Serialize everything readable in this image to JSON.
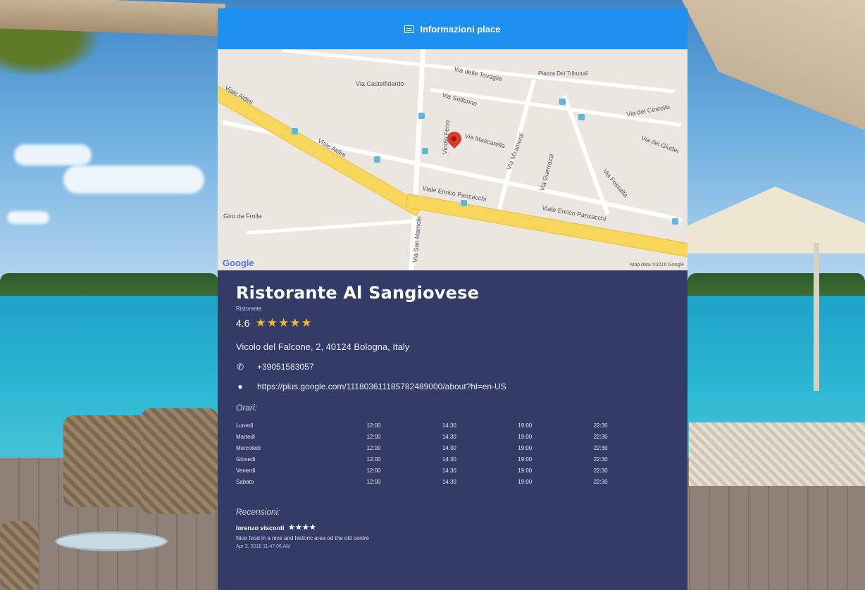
{
  "header": {
    "title": "Informazioni place",
    "icon": "calendar-icon"
  },
  "map": {
    "provider_logo": "Google",
    "credit": "Map data ©2016 Google",
    "streets": [
      "Viale Aldini",
      "Viale Aldini",
      "Viale Enrico Panzacchi",
      "Viale Enrico Panzacchi",
      "Via Castelfidardo",
      "Via delle Tovaglie",
      "Piazza Dei Tribunali",
      "Via Solferino",
      "Via Miramonti",
      "Via del Cestello",
      "Via Mascarella",
      "Via Guerrazzi",
      "Via Fossalta",
      "Via dei Giudei",
      "Vicolo Ferro",
      "Via San Mamolo",
      "Giro da Frolla"
    ],
    "marker_icon": "map-pin-icon"
  },
  "place": {
    "name": "Ristorante Al Sangiovese",
    "type": "Ristorante",
    "rating": "4.6",
    "rating_stars": 5,
    "address": "Vicolo del Falcone, 2, 40124 Bologna, Italy",
    "phone": "+39051583057",
    "phone_icon": "phone-icon",
    "website": "https://plus.google.com/111803611185782489000/about?hl=en-US",
    "website_icon": "globe-icon"
  },
  "hours": {
    "title": "Orari:",
    "rows": [
      {
        "day": "Lunedì",
        "t1": "12:00",
        "t2": "14:30",
        "t3": "19:00",
        "t4": "22:30"
      },
      {
        "day": "Martedì",
        "t1": "12:00",
        "t2": "14:30",
        "t3": "19:00",
        "t4": "22:30"
      },
      {
        "day": "Mercoledì",
        "t1": "12:00",
        "t2": "14:30",
        "t3": "19:00",
        "t4": "22:30"
      },
      {
        "day": "Giovedì",
        "t1": "12:00",
        "t2": "14:30",
        "t3": "19:00",
        "t4": "22:30"
      },
      {
        "day": "Venerdì",
        "t1": "12:00",
        "t2": "14:30",
        "t3": "19:00",
        "t4": "22:30"
      },
      {
        "day": "Sabato",
        "t1": "12:00",
        "t2": "14:30",
        "t3": "19:00",
        "t4": "22:30"
      }
    ]
  },
  "reviews": {
    "title": "Recensioni:",
    "items": [
      {
        "author": "lorenzo visconti",
        "stars": "★★★★",
        "text": "Nice food in a nice and historic area od the old centre",
        "date": "Apr 3, 2016 11:47:06 AM"
      }
    ]
  },
  "colors": {
    "header": "#1e90f0",
    "panel": "#333c66",
    "stars": "#f5b82e"
  }
}
